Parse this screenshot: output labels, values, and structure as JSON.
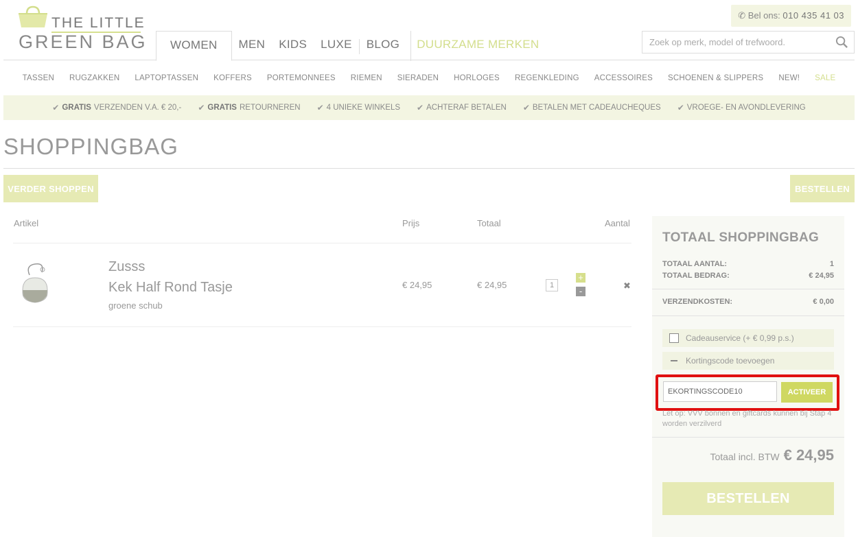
{
  "brand": {
    "line1": "THE LITTLE",
    "line2": "GREEN BAG"
  },
  "phone": {
    "label": "Bel ons:",
    "number": "010 435 41 03"
  },
  "main_nav": [
    {
      "label": "WOMEN"
    },
    {
      "label": "MEN"
    },
    {
      "label": "KIDS"
    },
    {
      "label": "LUXE"
    },
    {
      "label": "BLOG"
    },
    {
      "label": "DUURZAME MERKEN"
    }
  ],
  "search": {
    "placeholder": "Zoek op merk, model of trefwoord."
  },
  "sub_nav": [
    "TASSEN",
    "RUGZAKKEN",
    "LAPTOPTASSEN",
    "KOFFERS",
    "PORTEMONNEES",
    "RIEMEN",
    "SIERADEN",
    "HORLOGES",
    "REGENKLEDING",
    "ACCESSOIRES",
    "SCHOENEN & SLIPPERS",
    "NEW!",
    "SALE"
  ],
  "usps": [
    {
      "bold": "GRATIS",
      "text": "VERZENDEN V.A. € 20,-"
    },
    {
      "bold": "GRATIS",
      "text": "RETOURNEREN"
    },
    {
      "bold": "",
      "text": "4 UNIEKE WINKELS"
    },
    {
      "bold": "",
      "text": "ACHTERAF BETALEN"
    },
    {
      "bold": "",
      "text": "BETALEN MET CADEAUCHEQUES"
    },
    {
      "bold": "",
      "text": "VROEGE- EN AVONDLEVERING"
    }
  ],
  "page_title": "SHOPPINGBAG",
  "buttons": {
    "continue": "VERDER SHOPPEN",
    "order": "BESTELLEN"
  },
  "cart": {
    "headers": {
      "article": "Artikel",
      "price": "Prijs",
      "total": "Totaal",
      "quantity": "Aantal"
    },
    "items": [
      {
        "brand": "Zusss",
        "name": "Kek Half Rond Tasje",
        "variant": "groene schub",
        "price": "€ 24,95",
        "total": "€ 24,95",
        "quantity": "1"
      }
    ]
  },
  "summary": {
    "title": "TOTAAL SHOPPINGBAG",
    "count_label": "TOTAAL AANTAL:",
    "count_value": "1",
    "amount_label": "TOTAAL BEDRAG:",
    "amount_value": "€ 24,95",
    "shipping_label": "VERZENDKOSTEN:",
    "shipping_value": "€ 0,00",
    "gift_service": "Cadeauservice (+ € 0,99 p.s.)",
    "discount_toggle": "Kortingscode toevoegen",
    "discount_code": "EKORTINGSCODE10",
    "activate": "ACTIVEER",
    "note": "Let op: VVV bonnen en giftcards kunnen bij Stap 4 worden verzilverd",
    "total_label": "Totaal incl. BTW",
    "total_value": "€ 24,95",
    "order_button": "BESTELLEN"
  },
  "colors": {
    "accent": "#d3de8c",
    "band": "#f3f5e2",
    "highlight": "#e01010"
  }
}
